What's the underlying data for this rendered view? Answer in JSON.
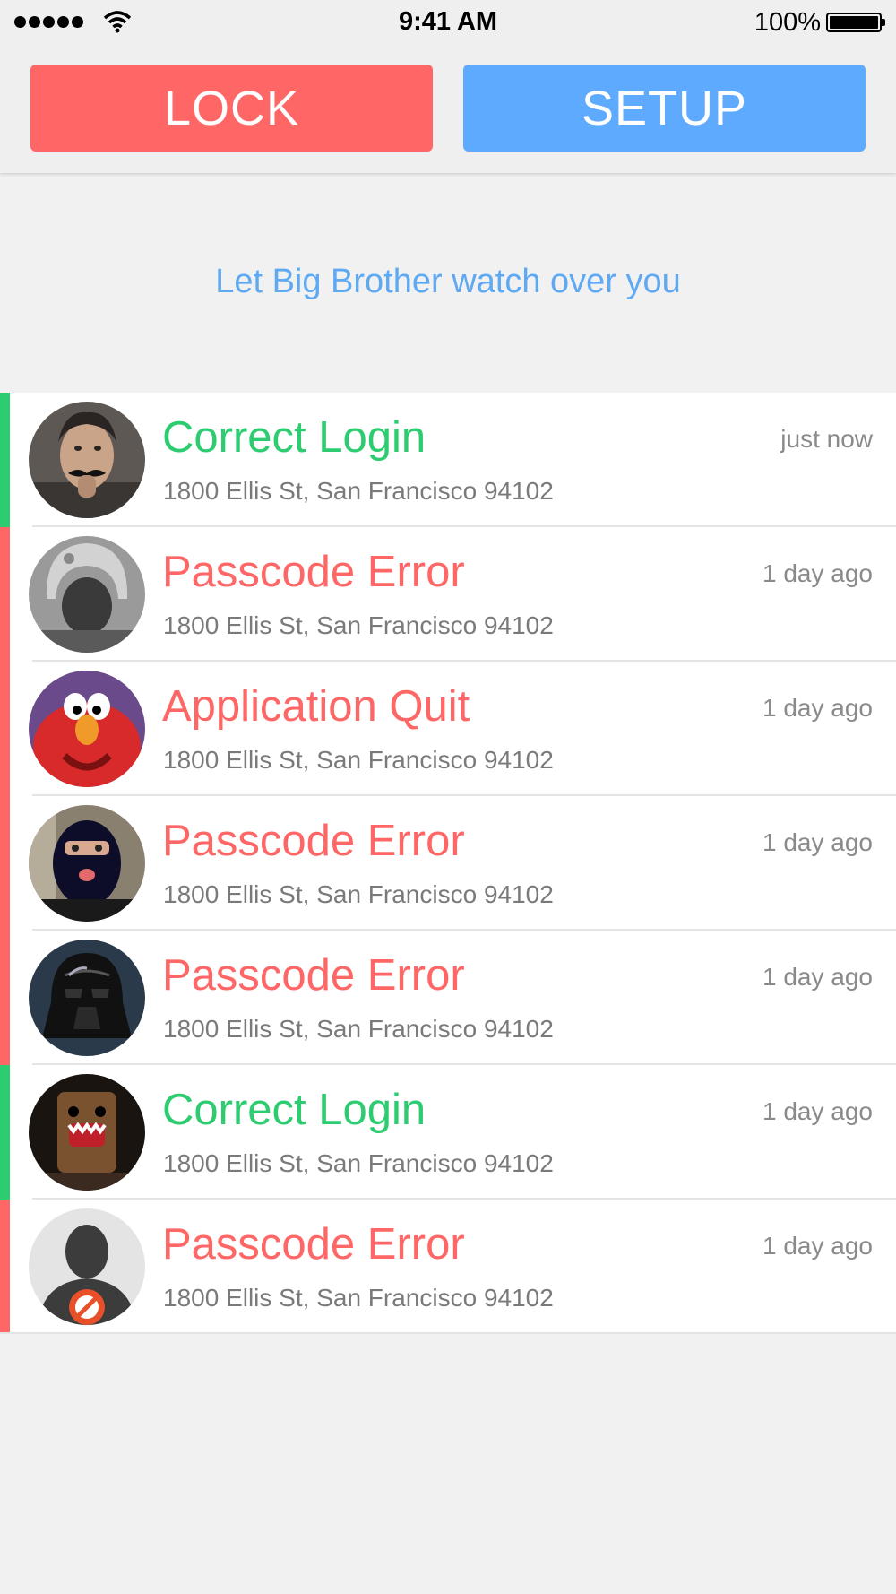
{
  "status_bar": {
    "time": "9:41 AM",
    "battery": "100%",
    "icons": [
      "signal-dots-icon",
      "wifi-icon",
      "battery-icon"
    ]
  },
  "header": {
    "lock_label": "LOCK",
    "setup_label": "SETUP",
    "lock_color": "#ff6666",
    "setup_color": "#5eaaff"
  },
  "tagline": "Let Big Brother watch over you",
  "colors": {
    "success": "#2ecc71",
    "error": "#ff6666",
    "accent": "#5ea9f2",
    "background": "#f1f1f1"
  },
  "events": [
    {
      "title": "Correct Login",
      "address": "1800 Ellis St, San Francisco 94102",
      "time": "just now",
      "status": "success"
    },
    {
      "title": "Passcode Error",
      "address": "1800 Ellis St, San Francisco 94102",
      "time": "1 day ago",
      "status": "error"
    },
    {
      "title": "Application Quit",
      "address": "1800 Ellis St, San Francisco 94102",
      "time": "1 day ago",
      "status": "error"
    },
    {
      "title": "Passcode Error",
      "address": "1800 Ellis St, San Francisco 94102",
      "time": "1 day ago",
      "status": "error"
    },
    {
      "title": "Passcode Error",
      "address": "1800 Ellis St, San Francisco 94102",
      "time": "1 day ago",
      "status": "error"
    },
    {
      "title": "Correct Login",
      "address": "1800 Ellis St, San Francisco 94102",
      "time": "1 day ago",
      "status": "success"
    },
    {
      "title": "Passcode Error",
      "address": "1800 Ellis St, San Francisco 94102",
      "time": "1 day ago",
      "status": "error"
    }
  ]
}
